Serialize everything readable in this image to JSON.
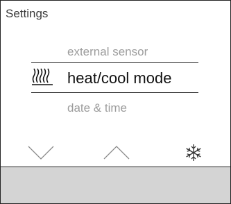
{
  "screen": {
    "title": "Settings"
  },
  "menu": {
    "previous_item": "external sensor",
    "selected_item": "heat/cool mode",
    "next_item": "date & time",
    "selected_icon": "heat-waves-icon"
  },
  "nav": {
    "down_icon": "chevron-down-icon",
    "up_icon": "chevron-up-icon",
    "mode_icon": "snowflake-icon"
  },
  "colors": {
    "text_dark": "#111111",
    "text_muted": "#9c9c9c",
    "bottom_bar": "#d4d4d4"
  }
}
